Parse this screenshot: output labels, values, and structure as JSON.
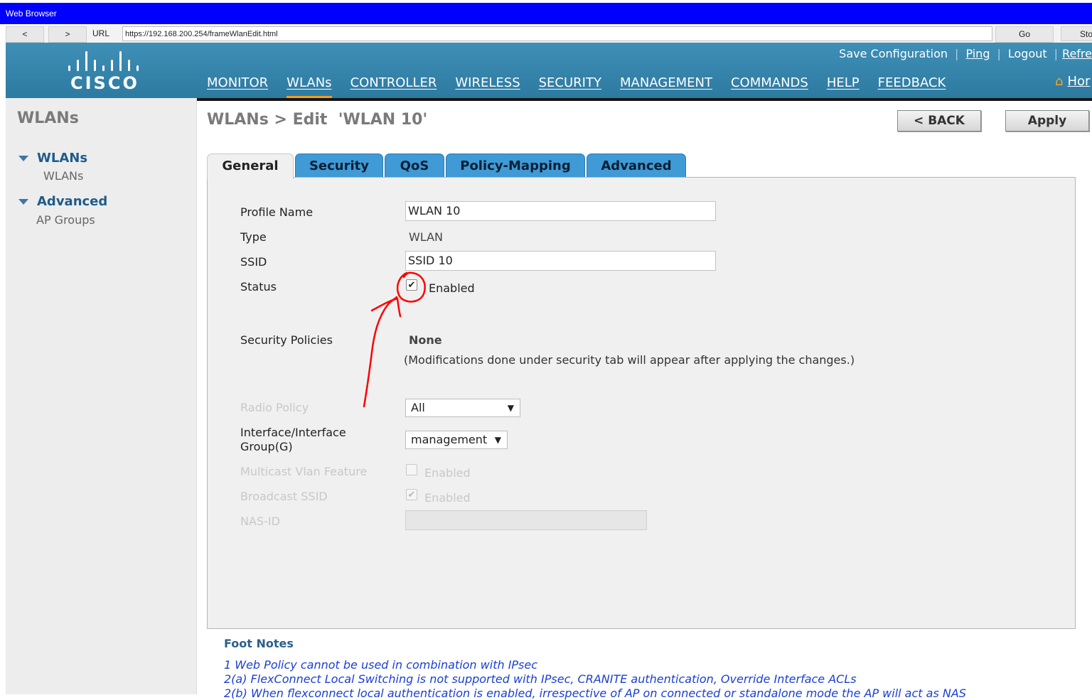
{
  "browser": {
    "title": "Web Browser",
    "back": "<",
    "forward": ">",
    "url_label": "URL",
    "url": "https://192.168.200.254/frameWlanEdit.html",
    "go": "Go",
    "stop": "Sto"
  },
  "header": {
    "logo_text": "CISCO",
    "top_links": [
      "Save Configuration",
      "Ping",
      "Logout",
      "Refre"
    ],
    "nav": [
      "MONITOR",
      "WLANs",
      "CONTROLLER",
      "WIRELESS",
      "SECURITY",
      "MANAGEMENT",
      "COMMANDS",
      "HELP",
      "FEEDBACK"
    ],
    "active_nav": "WLANs",
    "home": "Hor"
  },
  "sidebar": {
    "title": "WLANs",
    "sections": [
      {
        "label": "WLANs",
        "items": [
          "WLANs"
        ]
      },
      {
        "label": "Advanced",
        "items": [
          "AP Groups"
        ]
      }
    ]
  },
  "page": {
    "title": "WLANs > Edit  'WLAN 10'",
    "back_button": "< BACK",
    "apply_button": "Apply"
  },
  "tabs": [
    "General",
    "Security",
    "QoS",
    "Policy-Mapping",
    "Advanced"
  ],
  "active_tab": "General",
  "form": {
    "profile_name_label": "Profile Name",
    "profile_name_value": "WLAN 10",
    "type_label": "Type",
    "type_value": "WLAN",
    "ssid_label": "SSID",
    "ssid_value": "SSID 10",
    "status_label": "Status",
    "status_checked": true,
    "status_text": "Enabled",
    "security_policies_label": "Security Policies",
    "security_policies_value": "None",
    "security_note": "(Modifications done under security tab will appear after applying the changes.)",
    "radio_policy_label": "Radio Policy",
    "radio_policy_value": "All",
    "interface_label_line1": "Interface/Interface",
    "interface_label_line2": "Group(G)",
    "interface_value": "management",
    "multicast_label": "Multicast Vlan Feature",
    "multicast_checked": false,
    "multicast_text": "Enabled",
    "broadcast_label": "Broadcast SSID",
    "broadcast_checked": true,
    "broadcast_text": "Enabled",
    "nasid_label": "NAS-ID",
    "nasid_value": ""
  },
  "footnotes": {
    "title": "Foot Notes",
    "items": [
      "1 Web Policy cannot be used in combination with IPsec",
      "2(a) FlexConnect Local Switching is not supported with IPsec, CRANITE authentication, Override Interface ACLs",
      "2(b) When flexconnect local authentication is enabled, irrespective of AP on connected or standalone mode the AP will act as NAS"
    ]
  },
  "colors": {
    "header": "#3a88b0",
    "tab": "#3f9ad6",
    "active_nav_underline": "#f29d1f",
    "annotation": "#ff0000",
    "footnote_text": "#1a3fd6"
  }
}
